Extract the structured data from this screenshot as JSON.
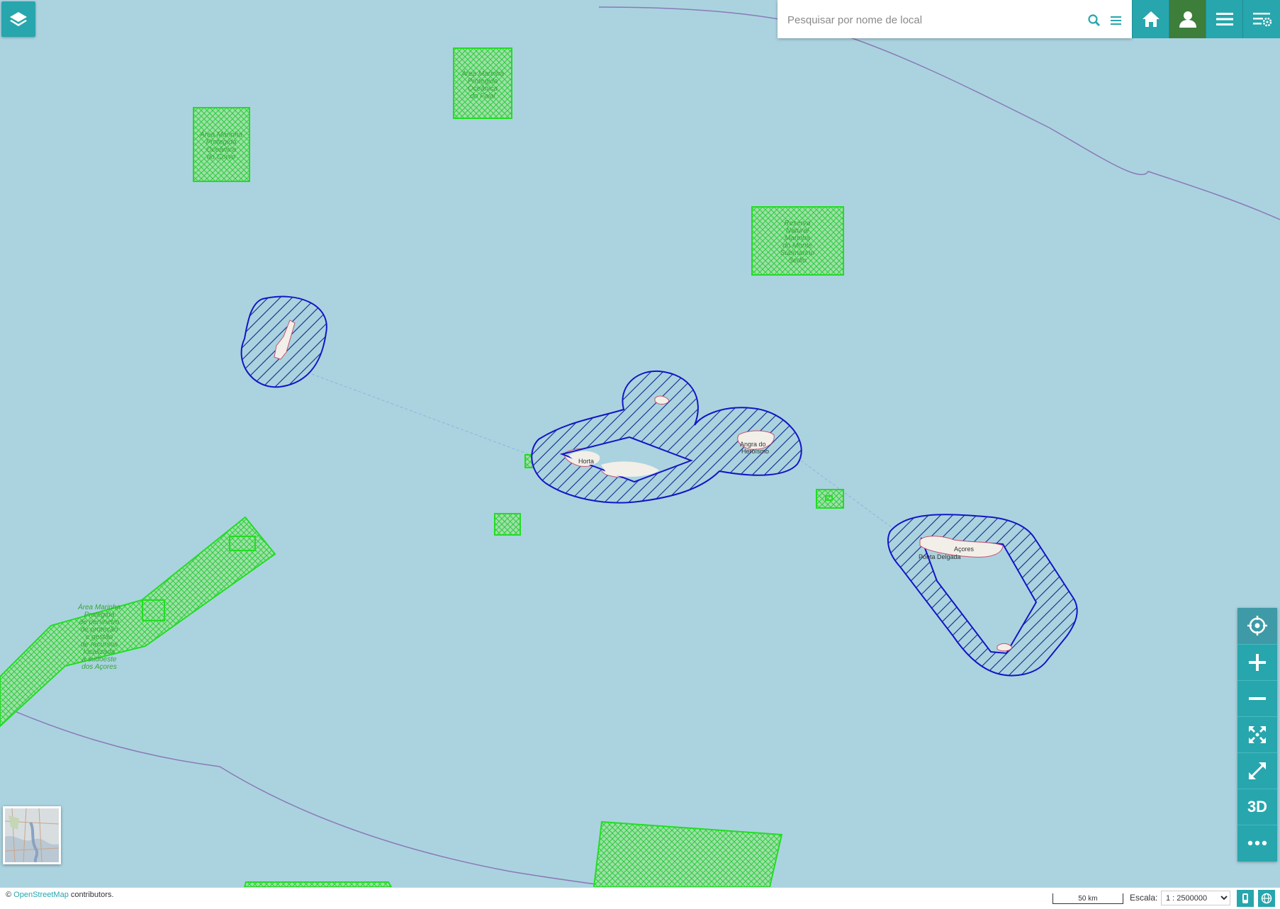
{
  "search": {
    "placeholder": "Pesquisar por nome de local"
  },
  "toolbar": {
    "layers_icon": "layers-icon",
    "home_icon": "home-icon",
    "user_icon": "user-icon",
    "menu_icon": "menu-icon",
    "settings_icon": "settings-list-icon"
  },
  "map_labels": {
    "area_corvo": [
      "Área Marinha",
      "Protegida",
      "Oceânica",
      "do Corvo"
    ],
    "area_faial": [
      "Área Marinha",
      "Protegida",
      "Oceânica",
      "do Faial"
    ],
    "reserva": [
      "Reserva",
      "Natural",
      "Marinha",
      "do Monte",
      "Submarino",
      "Sedlo"
    ],
    "area_sw": [
      "Área Marinha",
      "Protegida",
      "de perímetro",
      "de proteção",
      "e gestão",
      "de recursos",
      "localizada",
      "a sudoeste",
      "dos Açores"
    ],
    "horta": "Horta",
    "angra": "Angra do",
    "angra2": "Heroísmo",
    "acores": "Açores",
    "ponta_delgada": "Ponta Delgada"
  },
  "controls": {
    "locate_icon": "locate-icon",
    "zoom_in_icon": "plus-icon",
    "zoom_out_icon": "minus-icon",
    "fit_icon": "fit-extent-icon",
    "fullscreen_icon": "fullscreen-icon",
    "three_d_label": "3D",
    "more_icon": "more-icon"
  },
  "footer": {
    "attribution_prefix": "©",
    "attribution_link": "OpenStreetMap",
    "attribution_suffix": "contributors.",
    "scalebar_label": "50 km",
    "scale_label": "Escala:",
    "scale_value": "1 : 2500000"
  },
  "colors": {
    "sea": "#aad3df",
    "accent": "#27a6ad",
    "user_active": "#3d7e3a",
    "protected_green": "#22dd22",
    "hatched_blue": "#1414c8"
  }
}
